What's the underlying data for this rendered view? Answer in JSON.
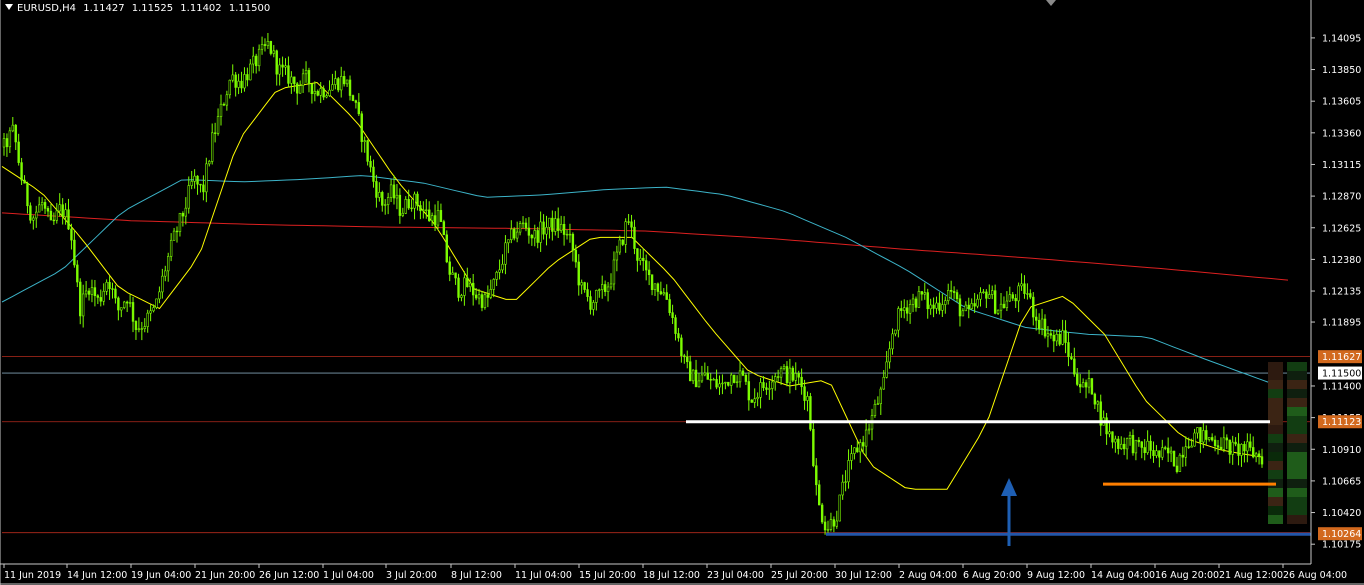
{
  "header": {
    "symbol": "EURUSD,H4",
    "open": "1.11427",
    "high": "1.11525",
    "low": "1.11402",
    "close": "1.11500"
  },
  "colors": {
    "background": "#000000",
    "candle": "#7CFC00",
    "ma_fast": "#FFFF00",
    "ma_medium": "#3CB3C8",
    "ma_slow": "#DC2020",
    "level_line": "#C83020",
    "current_price_line": "#A0C8E0",
    "support_white": "#FFFFFF",
    "support_orange": "#FF7F00",
    "support_blue": "#2255AA",
    "arrow": "#1E5FB4",
    "tag_orange": "#D2691E",
    "tag_current": "#FFFFFF"
  },
  "chart_data": {
    "type": "candlestick",
    "symbol": "EURUSD",
    "timeframe": "H4",
    "y_ticks": [
      "1.14095",
      "1.13850",
      "1.13605",
      "1.13360",
      "1.13115",
      "1.12870",
      "1.12625",
      "1.12380",
      "1.12135",
      "1.11895",
      "1.11400",
      "1.11155",
      "1.10910",
      "1.10665",
      "1.10420",
      "1.10175"
    ],
    "ylim": [
      1.1013,
      1.1428
    ],
    "x_ticks": [
      "11 Jun 2019",
      "14 Jun 12:00",
      "19 Jun 04:00",
      "21 Jun 20:00",
      "26 Jun 12:00",
      "1 Jul 04:00",
      "3 Jul 20:00",
      "8 Jul 12:00",
      "11 Jul 04:00",
      "15 Jul 20:00",
      "18 Jul 12:00",
      "23 Jul 04:00",
      "25 Jul 20:00",
      "30 Jul 12:00",
      "2 Aug 04:00",
      "6 Aug 20:00",
      "9 Aug 12:00",
      "14 Aug 04:00",
      "16 Aug 20:00",
      "21 Aug 12:00",
      "26 Aug 04:00"
    ],
    "close_path": [
      1.1325,
      1.1338,
      1.1295,
      1.127,
      1.1282,
      1.1262,
      1.1278,
      1.1265,
      1.12,
      1.1218,
      1.1205,
      1.1225,
      1.1198,
      1.121,
      1.1185,
      1.119,
      1.12,
      1.123,
      1.1255,
      1.1275,
      1.13,
      1.129,
      1.133,
      1.1355,
      1.138,
      1.1375,
      1.1385,
      1.1395,
      1.1405,
      1.1385,
      1.138,
      1.1372,
      1.1378,
      1.1368,
      1.137,
      1.1375,
      1.1378,
      1.136,
      1.133,
      1.13,
      1.128,
      1.129,
      1.1275,
      1.1285,
      1.128,
      1.127,
      1.1272,
      1.123,
      1.1215,
      1.1218,
      1.121,
      1.1205,
      1.1222,
      1.1245,
      1.126,
      1.1265,
      1.1255,
      1.1262,
      1.1265,
      1.1262,
      1.125,
      1.1215,
      1.1205,
      1.121,
      1.122,
      1.1245,
      1.127,
      1.124,
      1.1225,
      1.1218,
      1.121,
      1.1185,
      1.1155,
      1.1145,
      1.1148,
      1.1142,
      1.114,
      1.115,
      1.1148,
      1.113,
      1.1138,
      1.1145,
      1.1152,
      1.1148,
      1.1145,
      1.113,
      1.105,
      1.103,
      1.104,
      1.107,
      1.109,
      1.11,
      1.112,
      1.114,
      1.1185,
      1.12,
      1.1205,
      1.121,
      1.12,
      1.1205,
      1.1215,
      1.12,
      1.1195,
      1.1205,
      1.1215,
      1.12,
      1.1205,
      1.121,
      1.1215,
      1.1195,
      1.1185,
      1.1175,
      1.1178,
      1.1155,
      1.1138,
      1.114,
      1.1115,
      1.11,
      1.1095,
      1.1098,
      1.109,
      1.1093,
      1.1085,
      1.1088,
      1.108,
      1.1098,
      1.1102,
      1.11,
      1.1098,
      1.1095,
      1.109,
      1.1092,
      1.1088,
      1.1085
    ],
    "ma_fast": [
      1.131,
      1.129,
      1.1255,
      1.1215,
      1.12,
      1.124,
      1.133,
      1.137,
      1.1375,
      1.1345,
      1.13,
      1.1265,
      1.1215,
      1.1205,
      1.1235,
      1.1255,
      1.1255,
      1.1225,
      1.1185,
      1.115,
      1.114,
      1.1145,
      1.108,
      1.106,
      1.106,
      1.111,
      1.12,
      1.121,
      1.118,
      1.113,
      1.11,
      1.109,
      1.1085
    ],
    "ma_medium": [
      1.1205,
      1.123,
      1.1275,
      1.13,
      1.1298,
      1.13,
      1.1303,
      1.1297,
      1.1286,
      1.1288,
      1.1292,
      1.1294,
      1.1288,
      1.1275,
      1.1255,
      1.123,
      1.12,
      1.1185,
      1.118,
      1.1178,
      1.116,
      1.1143
    ],
    "ma_slow": [
      1.1274,
      1.1268,
      1.1265,
      1.1263,
      1.1262,
      1.126,
      1.1254,
      1.1246,
      1.1239,
      1.1231,
      1.1222
    ],
    "horizontal_levels": [
      1.11627,
      1.115,
      1.11123,
      1.10264
    ],
    "price_tags": [
      {
        "value": "1.11627",
        "kind": "orange"
      },
      {
        "value": "1.11500",
        "kind": "current"
      },
      {
        "value": "1.11123",
        "kind": "orange"
      },
      {
        "value": "1.10264",
        "kind": "orange"
      }
    ],
    "drawn_lines": [
      {
        "kind": "white",
        "price": 1.11123
      },
      {
        "kind": "orange",
        "price": 1.1064
      },
      {
        "kind": "blue",
        "price": 1.10264
      }
    ],
    "arrow": {
      "direction": "up"
    }
  }
}
